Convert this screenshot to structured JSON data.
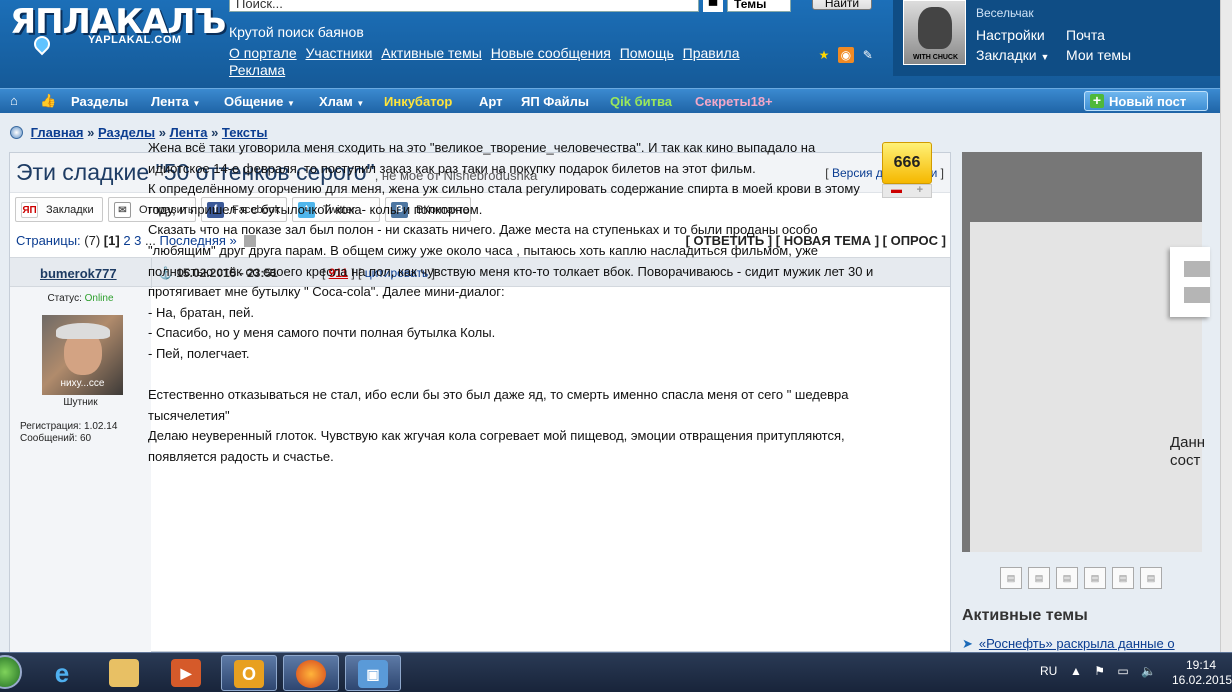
{
  "header": {
    "logo_text": "ЯПЛАКАЛЪ",
    "logo_sub": "YAPLAKAL.COM",
    "search_placeholder": "Поиск...",
    "search_scope": "Темы",
    "search_button": "Найти",
    "tagline": "Крутой поиск баянов",
    "links": [
      "О портале",
      "Участники",
      "Активные темы",
      "Новые сообщения",
      "Помощь",
      "Правила",
      "Реклама"
    ]
  },
  "userbox": {
    "avatar_caption": "WITH CHUCK",
    "status": "Весельчак",
    "settings": "Настройки",
    "mail": "Почта",
    "bookmarks": "Закладки",
    "my_topics": "Мои темы"
  },
  "nav": {
    "items": [
      "Разделы",
      "Лента",
      "Общение",
      "Хлам",
      "Инкубатор",
      "Арт",
      "ЯП Файлы",
      "Qik битва",
      "Секреты18+"
    ],
    "new_post": "Новый пост"
  },
  "breadcrumb": [
    "Главная",
    "Разделы",
    "Лента",
    "Тексты"
  ],
  "topic": {
    "title": "Эти сладкие \"50 оттенков серого\"",
    "subtitle": ", не мое от Nishebrodushka",
    "print_version": "Версия для печати"
  },
  "share": [
    "Закладки",
    "Отправить",
    "Facebook",
    "Twitter",
    "ВКонтакте"
  ],
  "pagination": {
    "label": "Страницы:",
    "count": "(7)",
    "current": "[1]",
    "pages": [
      "2",
      "3"
    ],
    "last": "Последняя »",
    "actions": "[ ОТВЕТИТЬ ] [ НОВАЯ ТЕМА ] [ ОПРОС ]"
  },
  "post": {
    "author": "bumerok777",
    "date": "15.02.2015 - 23:51",
    "number": "911",
    "quote": "цитировать",
    "status_label": "Статус:",
    "status_value": "Online",
    "avatar_caption": "ниху...ссе",
    "rank": "Шутник",
    "registration": "Регистрация: 1.02.14",
    "messages": "Сообщений: 60",
    "rating": "666",
    "body": [
      "Жена всё таки уговорила меня сходить на это \"великое_творение_человечества\". И так как кино выпадало на идиотское 14-е февраля, то поступил заказ как раз таки на покупку подарок билетов на этот фильм.",
      "К определённому огорчению для меня, жена уж сильно стала регулировать содержание спирта в моей крови в этому году, и пришел я с бутылочкой кока- колы и попкорном.",
      "Сказать что на показе зал был полон - ни сказать ничего. Даже места на ступеньках и то были проданы особо \"любящим\" друг друга парам. В общем сижу уже около часа , пытаюсь хоть каплю насладиться фильмом, уже полностью стёк со своего кресла на пол, как чувствую меня кто-то толкает вбок. Поворачиваюсь - сидит мужик лет 30 и протягивает мне бутылку \" Coca-cola\". Далее мини-диалог:",
      "- На, братан, пей.",
      "- Спасибо, но у меня самого почти полная бутылка Колы.",
      "- Пей, полегчает.",
      " ",
      "Естественно отказываться не стал, ибо если бы это был даже яд, то смерть именно спасла меня от сего \" шедевра тысячелетия\"",
      "Делаю неуверенный глоток. Чувствую как жгучая кола согревает мой пищевод, эмоции отвращения притупляются, появляется радость и счастье."
    ]
  },
  "sidebar": {
    "ad_text_1": "Данн",
    "ad_text_2": "сост",
    "active_topics_title": "Активные темы",
    "active_topic_1": "«Роснефть» раскрыла данные о"
  },
  "taskbar": {
    "lang": "RU",
    "time": "19:14",
    "date": "16.02.2015"
  }
}
